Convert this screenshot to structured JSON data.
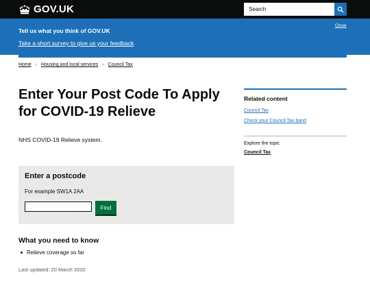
{
  "header": {
    "logo_text": "GOV.UK",
    "search_placeholder": "Search"
  },
  "banner": {
    "title": "Tell us what you think of GOV.UK",
    "link": "Take a short survey to give us your feedback",
    "close": "Close"
  },
  "breadcrumb": [
    "Home",
    "Housing and local services",
    "Council Tax"
  ],
  "main": {
    "title": "Enter Your Post Code To Apply for COVID-19 Relieve",
    "lede": "NHS COVID-19 Relieve system.",
    "postcode": {
      "heading": "Enter a postcode",
      "hint": "For example SW1A 2AA",
      "value": "",
      "button": "Find"
    },
    "need_heading": "What you need to know",
    "need_items": [
      "Relieve coverage so far"
    ],
    "updated": "Last updated: 20 March 2020"
  },
  "sidebar": {
    "related_heading": "Related content",
    "related_links": [
      "Council Tax",
      "Check your Council Tax band"
    ],
    "explore_label": "Explore the topic",
    "explore_link": "Council Tax"
  },
  "colors": {
    "header": "#0b0c0c",
    "brand_blue": "#1d70b8",
    "button_green": "#00703c",
    "panel_grey": "#e9e9e9"
  }
}
